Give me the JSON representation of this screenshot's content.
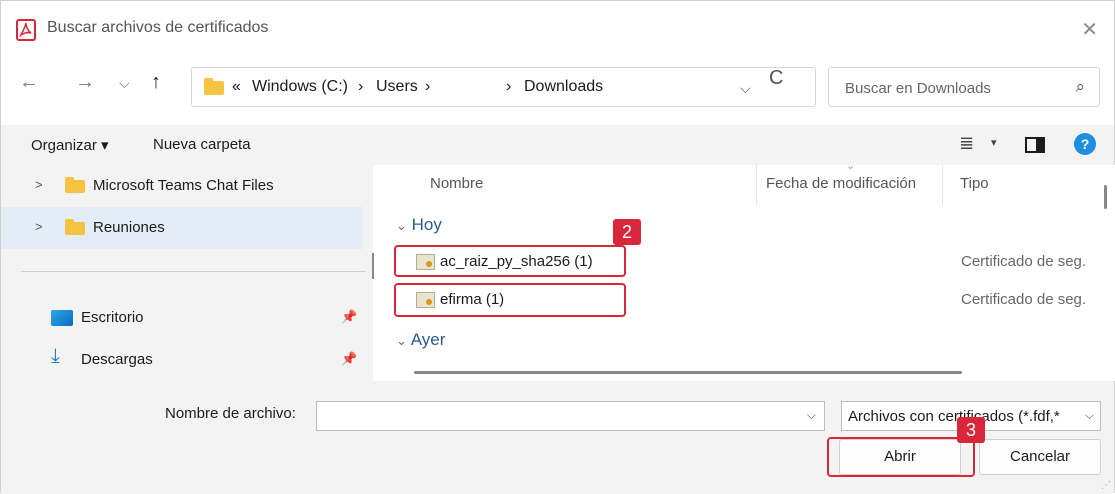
{
  "window": {
    "title": "Buscar archivos de certificados",
    "close_glyph": "✕"
  },
  "nav": {
    "back": "←",
    "forward": "→",
    "recent": "⌵",
    "up": "↑",
    "breadcrumb": {
      "overflow": "«",
      "items": [
        "Windows (C:)",
        "Users",
        "Downloads"
      ],
      "sep": "›"
    },
    "dropdown": "⌵",
    "refresh": "C",
    "search_placeholder": "Buscar en Downloads",
    "search_glyph": "⌕"
  },
  "toolbar": {
    "organize": "Organizar ▾",
    "new_folder": "Nueva carpeta",
    "view_glyph": "≣",
    "view_dd": "▾",
    "help": "?"
  },
  "nav_pane": {
    "folders": [
      {
        "label": "Microsoft Teams Chat Files",
        "selected": false
      },
      {
        "label": "Reuniones",
        "selected": true
      }
    ],
    "quick_access": [
      {
        "label": "Escritorio",
        "icon": "desktop-icon"
      },
      {
        "label": "Descargas",
        "icon": "download-icon"
      }
    ],
    "chevron": ">",
    "pin": "📌"
  },
  "files": {
    "columns": [
      "Nombre",
      "Fecha de modificación",
      "Tipo"
    ],
    "sort_glyph": "⌄",
    "groups": [
      "Hoy",
      "Ayer"
    ],
    "group_chevron": "⌄",
    "rows": [
      {
        "name": "ac_raiz_py_sha256 (1)",
        "type": "Certificado de seg."
      },
      {
        "name": "efirma (1)",
        "type": "Certificado de seg."
      }
    ]
  },
  "annotations": {
    "step2": "2",
    "step3": "3",
    "color": "#d8263a"
  },
  "bottom": {
    "filename_label": "Nombre de archivo:",
    "filename_value": "",
    "filetype_value": "Archivos con certificados (*.fdf,*",
    "dd_glyph": "⌵",
    "open": "Abrir",
    "cancel": "Cancelar"
  }
}
